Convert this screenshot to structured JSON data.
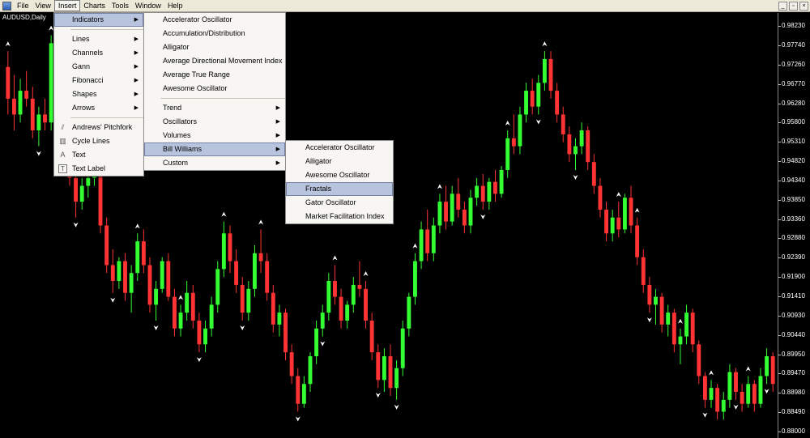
{
  "menubar": {
    "items": [
      "File",
      "View",
      "Insert",
      "Charts",
      "Tools",
      "Window",
      "Help"
    ],
    "open_item": "Insert"
  },
  "chart": {
    "symbol": "AUDUSD,Daily",
    "colors": {
      "bull": "#33ff33",
      "bear": "#ff3333",
      "fractal": "#ffffff",
      "background": "#000000"
    },
    "price_labels": [
      "0.98230",
      "0.97740",
      "0.97260",
      "0.96770",
      "0.96280",
      "0.95800",
      "0.95310",
      "0.94820",
      "0.94340",
      "0.93850",
      "0.93360",
      "0.92880",
      "0.92390",
      "0.91900",
      "0.91410",
      "0.90930",
      "0.90440",
      "0.89950",
      "0.89470",
      "0.88980",
      "0.88490",
      "0.88000"
    ]
  },
  "chart_data": {
    "type": "candlestick",
    "series_name": "AUDUSD,Daily",
    "ylim": [
      0.88,
      0.984
    ],
    "candles": [
      [
        0.972,
        0.976,
        0.96,
        0.964
      ],
      [
        0.964,
        0.97,
        0.956,
        0.96
      ],
      [
        0.96,
        0.969,
        0.958,
        0.966
      ],
      [
        0.966,
        0.971,
        0.962,
        0.964
      ],
      [
        0.964,
        0.967,
        0.954,
        0.956
      ],
      [
        0.956,
        0.962,
        0.952,
        0.96
      ],
      [
        0.96,
        0.964,
        0.956,
        0.958
      ],
      [
        0.958,
        0.98,
        0.956,
        0.978
      ],
      [
        0.978,
        0.979,
        0.962,
        0.964
      ],
      [
        0.964,
        0.966,
        0.95,
        0.952
      ],
      [
        0.952,
        0.954,
        0.942,
        0.944
      ],
      [
        0.944,
        0.95,
        0.934,
        0.938
      ],
      [
        0.938,
        0.944,
        0.936,
        0.942
      ],
      [
        0.942,
        0.946,
        0.939,
        0.944
      ],
      [
        0.944,
        0.95,
        0.942,
        0.946
      ],
      [
        0.946,
        0.947,
        0.93,
        0.932
      ],
      [
        0.932,
        0.934,
        0.92,
        0.922
      ],
      [
        0.922,
        0.926,
        0.915,
        0.918
      ],
      [
        0.918,
        0.924,
        0.916,
        0.923
      ],
      [
        0.923,
        0.925,
        0.913,
        0.915
      ],
      [
        0.915,
        0.922,
        0.91,
        0.92
      ],
      [
        0.92,
        0.93,
        0.918,
        0.928
      ],
      [
        0.928,
        0.931,
        0.92,
        0.922
      ],
      [
        0.922,
        0.924,
        0.91,
        0.912
      ],
      [
        0.912,
        0.918,
        0.908,
        0.916
      ],
      [
        0.916,
        0.924,
        0.915,
        0.923
      ],
      [
        0.923,
        0.925,
        0.913,
        0.914
      ],
      [
        0.914,
        0.916,
        0.904,
        0.906
      ],
      [
        0.906,
        0.912,
        0.904,
        0.91
      ],
      [
        0.91,
        0.918,
        0.908,
        0.915
      ],
      [
        0.915,
        0.917,
        0.906,
        0.908
      ],
      [
        0.908,
        0.91,
        0.9,
        0.902
      ],
      [
        0.902,
        0.908,
        0.9,
        0.906
      ],
      [
        0.906,
        0.914,
        0.904,
        0.912
      ],
      [
        0.912,
        0.923,
        0.91,
        0.921
      ],
      [
        0.921,
        0.933,
        0.919,
        0.93
      ],
      [
        0.93,
        0.932,
        0.92,
        0.923
      ],
      [
        0.923,
        0.926,
        0.915,
        0.917
      ],
      [
        0.917,
        0.919,
        0.908,
        0.91
      ],
      [
        0.91,
        0.918,
        0.908,
        0.916
      ],
      [
        0.916,
        0.927,
        0.914,
        0.925
      ],
      [
        0.925,
        0.931,
        0.92,
        0.923
      ],
      [
        0.923,
        0.925,
        0.913,
        0.915
      ],
      [
        0.915,
        0.917,
        0.905,
        0.907
      ],
      [
        0.907,
        0.912,
        0.904,
        0.91
      ],
      [
        0.91,
        0.911,
        0.898,
        0.9
      ],
      [
        0.9,
        0.902,
        0.892,
        0.894
      ],
      [
        0.894,
        0.896,
        0.885,
        0.887
      ],
      [
        0.887,
        0.894,
        0.886,
        0.892
      ],
      [
        0.892,
        0.9,
        0.89,
        0.899
      ],
      [
        0.899,
        0.908,
        0.897,
        0.906
      ],
      [
        0.906,
        0.912,
        0.904,
        0.91
      ],
      [
        0.91,
        0.92,
        0.908,
        0.918
      ],
      [
        0.918,
        0.922,
        0.912,
        0.914
      ],
      [
        0.914,
        0.916,
        0.906,
        0.908
      ],
      [
        0.908,
        0.913,
        0.906,
        0.912
      ],
      [
        0.912,
        0.919,
        0.91,
        0.917
      ],
      [
        0.917,
        0.923,
        0.914,
        0.916
      ],
      [
        0.916,
        0.918,
        0.906,
        0.908
      ],
      [
        0.908,
        0.91,
        0.898,
        0.9
      ],
      [
        0.9,
        0.902,
        0.891,
        0.893
      ],
      [
        0.893,
        0.901,
        0.89,
        0.899
      ],
      [
        0.899,
        0.902,
        0.889,
        0.891
      ],
      [
        0.891,
        0.898,
        0.888,
        0.896
      ],
      [
        0.896,
        0.908,
        0.894,
        0.906
      ],
      [
        0.906,
        0.915,
        0.904,
        0.914
      ],
      [
        0.914,
        0.925,
        0.912,
        0.923
      ],
      [
        0.923,
        0.933,
        0.921,
        0.931
      ],
      [
        0.931,
        0.936,
        0.923,
        0.925
      ],
      [
        0.925,
        0.934,
        0.923,
        0.932
      ],
      [
        0.932,
        0.94,
        0.93,
        0.938
      ],
      [
        0.938,
        0.942,
        0.931,
        0.933
      ],
      [
        0.933,
        0.942,
        0.932,
        0.94
      ],
      [
        0.94,
        0.944,
        0.934,
        0.936
      ],
      [
        0.936,
        0.938,
        0.93,
        0.932
      ],
      [
        0.932,
        0.941,
        0.93,
        0.939
      ],
      [
        0.939,
        0.944,
        0.937,
        0.942
      ],
      [
        0.942,
        0.945,
        0.936,
        0.938
      ],
      [
        0.938,
        0.944,
        0.936,
        0.943
      ],
      [
        0.943,
        0.946,
        0.938,
        0.94
      ],
      [
        0.94,
        0.947,
        0.939,
        0.946
      ],
      [
        0.946,
        0.956,
        0.944,
        0.954
      ],
      [
        0.954,
        0.96,
        0.95,
        0.952
      ],
      [
        0.952,
        0.962,
        0.95,
        0.96
      ],
      [
        0.96,
        0.968,
        0.958,
        0.966
      ],
      [
        0.966,
        0.969,
        0.96,
        0.962
      ],
      [
        0.962,
        0.97,
        0.96,
        0.968
      ],
      [
        0.968,
        0.976,
        0.966,
        0.974
      ],
      [
        0.974,
        0.976,
        0.964,
        0.966
      ],
      [
        0.966,
        0.968,
        0.958,
        0.96
      ],
      [
        0.96,
        0.962,
        0.953,
        0.955
      ],
      [
        0.955,
        0.957,
        0.948,
        0.95
      ],
      [
        0.95,
        0.954,
        0.946,
        0.952
      ],
      [
        0.952,
        0.958,
        0.95,
        0.956
      ],
      [
        0.956,
        0.957,
        0.946,
        0.948
      ],
      [
        0.948,
        0.95,
        0.94,
        0.942
      ],
      [
        0.942,
        0.944,
        0.934,
        0.936
      ],
      [
        0.936,
        0.938,
        0.928,
        0.93
      ],
      [
        0.93,
        0.936,
        0.928,
        0.934
      ],
      [
        0.934,
        0.938,
        0.929,
        0.931
      ],
      [
        0.931,
        0.94,
        0.93,
        0.939
      ],
      [
        0.939,
        0.942,
        0.93,
        0.932
      ],
      [
        0.932,
        0.934,
        0.922,
        0.924
      ],
      [
        0.924,
        0.926,
        0.915,
        0.917
      ],
      [
        0.917,
        0.919,
        0.91,
        0.912
      ],
      [
        0.912,
        0.916,
        0.907,
        0.914
      ],
      [
        0.914,
        0.915,
        0.905,
        0.907
      ],
      [
        0.907,
        0.912,
        0.904,
        0.91
      ],
      [
        0.91,
        0.911,
        0.9,
        0.902
      ],
      [
        0.902,
        0.906,
        0.897,
        0.904
      ],
      [
        0.904,
        0.912,
        0.902,
        0.91
      ],
      [
        0.91,
        0.911,
        0.9,
        0.902
      ],
      [
        0.902,
        0.903,
        0.892,
        0.894
      ],
      [
        0.894,
        0.895,
        0.886,
        0.888
      ],
      [
        0.888,
        0.893,
        0.886,
        0.891
      ],
      [
        0.891,
        0.892,
        0.883,
        0.885
      ],
      [
        0.885,
        0.89,
        0.883,
        0.888
      ],
      [
        0.888,
        0.897,
        0.886,
        0.895
      ],
      [
        0.895,
        0.896,
        0.888,
        0.89
      ],
      [
        0.89,
        0.892,
        0.885,
        0.887
      ],
      [
        0.887,
        0.894,
        0.886,
        0.892
      ],
      [
        0.892,
        0.893,
        0.885,
        0.887
      ],
      [
        0.887,
        0.896,
        0.886,
        0.894
      ],
      [
        0.894,
        0.901,
        0.892,
        0.899
      ],
      [
        0.899,
        0.9,
        0.89,
        0.892
      ]
    ],
    "fractals_up": [
      0,
      7,
      21,
      28,
      35,
      41,
      53,
      58,
      66,
      70,
      81,
      87,
      99,
      102,
      109,
      114,
      120
    ],
    "fractals_down": [
      5,
      11,
      17,
      24,
      31,
      38,
      47,
      51,
      60,
      63,
      77,
      86,
      92,
      104,
      113,
      118,
      123
    ]
  },
  "insert_menu": {
    "items": [
      {
        "label": "Indicators",
        "submenu": true,
        "highlighted": true,
        "icon": ""
      },
      {
        "separator": true
      },
      {
        "label": "Lines",
        "submenu": true,
        "icon": ""
      },
      {
        "label": "Channels",
        "submenu": true,
        "icon": ""
      },
      {
        "label": "Gann",
        "submenu": true,
        "icon": ""
      },
      {
        "label": "Fibonacci",
        "submenu": true,
        "icon": ""
      },
      {
        "label": "Shapes",
        "submenu": true,
        "icon": ""
      },
      {
        "label": "Arrows",
        "submenu": true,
        "icon": ""
      },
      {
        "separator": true
      },
      {
        "label": "Andrews' Pitchfork",
        "submenu": false,
        "icon": "pitchfork-icon"
      },
      {
        "label": "Cycle Lines",
        "submenu": false,
        "icon": "cycle-lines-icon"
      },
      {
        "label": "Text",
        "submenu": false,
        "icon": "text-icon"
      },
      {
        "label": "Text Label",
        "submenu": false,
        "icon": "text-label-icon"
      }
    ]
  },
  "indicators_menu": {
    "items": [
      {
        "label": "Accelerator Oscillator",
        "submenu": false
      },
      {
        "label": "Accumulation/Distribution",
        "submenu": false
      },
      {
        "label": "Alligator",
        "submenu": false
      },
      {
        "label": "Average Directional Movement Index",
        "submenu": false
      },
      {
        "label": "Average True Range",
        "submenu": false
      },
      {
        "label": "Awesome Oscillator",
        "submenu": false
      },
      {
        "separator": true
      },
      {
        "label": "Trend",
        "submenu": true
      },
      {
        "label": "Oscillators",
        "submenu": true
      },
      {
        "label": "Volumes",
        "submenu": true
      },
      {
        "label": "Bill Williams",
        "submenu": true,
        "highlighted": true
      },
      {
        "label": "Custom",
        "submenu": true
      }
    ]
  },
  "bill_williams_menu": {
    "items": [
      {
        "label": "Accelerator Oscillator"
      },
      {
        "label": "Alligator"
      },
      {
        "label": "Awesome Oscillator"
      },
      {
        "label": "Fractals",
        "highlighted": true
      },
      {
        "label": "Gator Oscillator"
      },
      {
        "label": "Market Facilitation Index"
      }
    ]
  }
}
